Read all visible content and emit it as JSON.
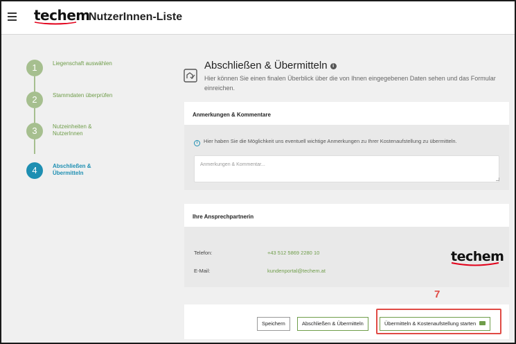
{
  "header": {
    "brand": "techem",
    "title": "NutzerInnen-Liste"
  },
  "steps": [
    {
      "number": "1",
      "label": "Liegenschaft auswählen",
      "state": "done"
    },
    {
      "number": "2",
      "label": "Stammdaten überprüfen",
      "state": "done"
    },
    {
      "number": "3",
      "label": "Nutzeinheiten & NutzerInnen",
      "state": "done"
    },
    {
      "number": "4",
      "label": "Abschließen & Übermitteln",
      "state": "active"
    }
  ],
  "main": {
    "title": "Abschließen & Übermitteln",
    "info_icon": "i",
    "subtitle": "Hier können Sie einen finalen Überblick über die von Ihnen eingegebenen Daten sehen und das Formular einreichen."
  },
  "comments": {
    "heading": "Anmerkungen & Kommentare",
    "hint_icon": "i",
    "hint": "Hier haben Sie die Möglichkeit uns eventuell wichtige Anmerkungen zu Ihrer Kostenaufstellung zu übermitteln.",
    "placeholder": "Anmerkungen & Kommentar...",
    "value": ""
  },
  "contact": {
    "heading": "Ihre Ansprechpartnerin",
    "phone_label": "Telefon:",
    "phone": "+43 512 5869 2280 10",
    "email_label": "E-Mail:",
    "email": "kundenportal@techem.at",
    "brand": "techem"
  },
  "actions": {
    "save": "Speichern",
    "finish": "Abschließen & Übermitteln",
    "submit": "Übermitteln & Kostenaufstellung starten",
    "submit_icon": "send-icon"
  },
  "annotation": "7",
  "colors": {
    "green": "#6f9d4a",
    "step_done": "#a6bf8f",
    "step_active": "#1e8fb2",
    "highlight": "#e04a44",
    "brand_red": "#e2001a"
  }
}
